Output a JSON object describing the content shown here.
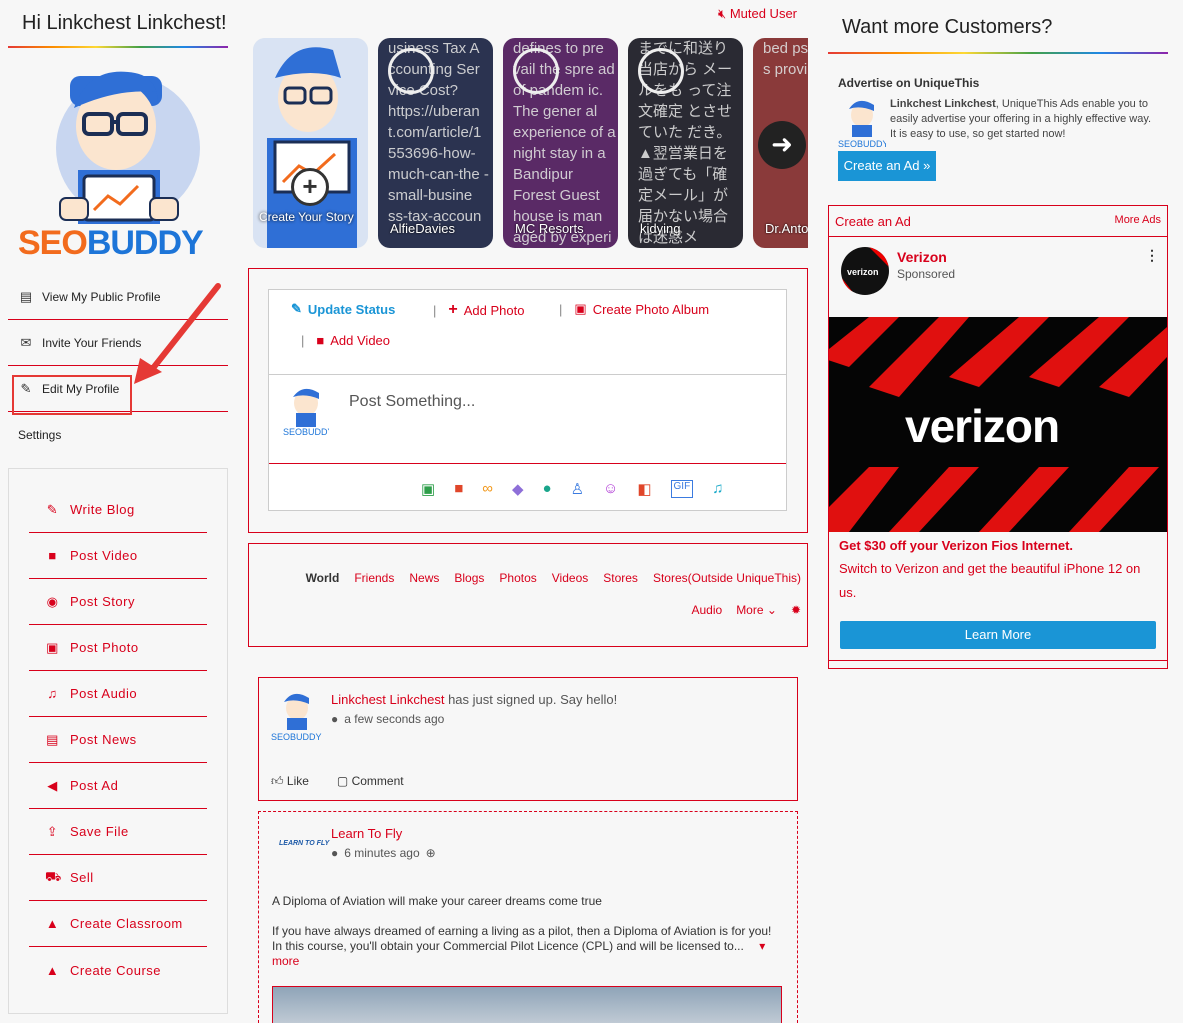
{
  "greeting": "Hi Linkchest Linkchest!",
  "logo": {
    "seo": "SEO",
    "buddy": "BUDDY"
  },
  "profile_menu": [
    {
      "label": "View My Public Profile",
      "icon": "id-card-icon"
    },
    {
      "label": "Invite Your Friends",
      "icon": "envelope-icon"
    },
    {
      "label": "Edit My Profile",
      "icon": "edit-icon"
    },
    {
      "label": "Settings",
      "icon": ""
    }
  ],
  "quick_menu": [
    {
      "label": "Write Blog",
      "icon": "pencil-icon"
    },
    {
      "label": "Post Video",
      "icon": "video-icon"
    },
    {
      "label": "Post Story",
      "icon": "eye-icon"
    },
    {
      "label": "Post Photo",
      "icon": "image-icon"
    },
    {
      "label": "Post Audio",
      "icon": "music-icon"
    },
    {
      "label": "Post News",
      "icon": "newspaper-icon"
    },
    {
      "label": "Post Ad",
      "icon": "megaphone-icon"
    },
    {
      "label": "Save File",
      "icon": "upload-icon"
    },
    {
      "label": "Sell",
      "icon": "cart-icon"
    },
    {
      "label": "Create Classroom",
      "icon": "graduation-cap-icon"
    },
    {
      "label": "Create Course",
      "icon": "graduation-cap-icon"
    }
  ],
  "muted_user": "Muted User",
  "stories": {
    "create_label": "Create Your Story",
    "items": [
      {
        "name": "AlfieDavies",
        "text": "usiness Tax A ccounting Ser vice Cost? https://uberan t.com/article/1 553696-how- much-can-the -small-busine ss-tax-accoun",
        "bg": "#2b3350"
      },
      {
        "name": "MC Resorts",
        "text": "defines to pre vail the spre ad of pandem ic. The gener al experience of a night stay in a Bandipur Forest Guest house is man aged by experi",
        "bg": "#5a2a66"
      },
      {
        "name": "kidying",
        "text": "までに和送り 当店から メールをも って注文確定 とさせていた だき。 ▲翌営業日を 過ぎても「確 定メール」が 届かない場合 は迷惑メ",
        "bg": "#2a2a33"
      },
      {
        "name": "Dr.Anto",
        "text": "bed ps same t s provi",
        "bg": "#8a3a3a"
      }
    ]
  },
  "composer": {
    "tabs": [
      "Update Status",
      "Add Photo",
      "Create Photo Album",
      "Add Video"
    ],
    "placeholder": "Post Something..."
  },
  "filters": {
    "row1": [
      "World",
      "Friends",
      "News",
      "Blogs",
      "Photos",
      "Videos",
      "Stores",
      "Stores(Outside UniqueThis)"
    ],
    "row2": [
      "Audio",
      "More"
    ]
  },
  "feed": [
    {
      "name": "Linkchest Linkchest",
      "action": "has just signed up. Say hello!",
      "time": "a few seconds ago",
      "like": "Like",
      "comment": "Comment"
    },
    {
      "name": "Learn To Fly",
      "time": "6 minutes ago",
      "title": "A Diploma of Aviation will make your career dreams come true",
      "body": "If you have always dreamed of earning a living as a pilot, then a Diploma of Aviation is for you! In this course, you'll obtain your Commercial Pilot Licence (CPL) and will be licensed to...",
      "more": "more"
    }
  ],
  "right": {
    "title": "Want more Customers?",
    "advertise_title": "Advertise on UniqueThis",
    "advertise_name": "Linkchest Linkchest",
    "advertise_text": ", UniqueThis Ads enable you to easily advertise your offering in a highly effective way. It is easy to use, so get started now!",
    "create_ad_btn": "Create an Ad »",
    "create_ad": "Create an Ad",
    "more_ads": "More Ads",
    "ad": {
      "brand": "Verizon",
      "sponsored": "Sponsored",
      "logo_text": "verizon",
      "image_word": "verizon",
      "headline": "Get $30 off your Verizon Fios Internet.",
      "desc": "Switch to Verizon and get the beautiful iPhone 12 on us.",
      "cta": "Learn More"
    }
  },
  "colors": {
    "accent": "#d8001b",
    "blue": "#1a95d6"
  }
}
